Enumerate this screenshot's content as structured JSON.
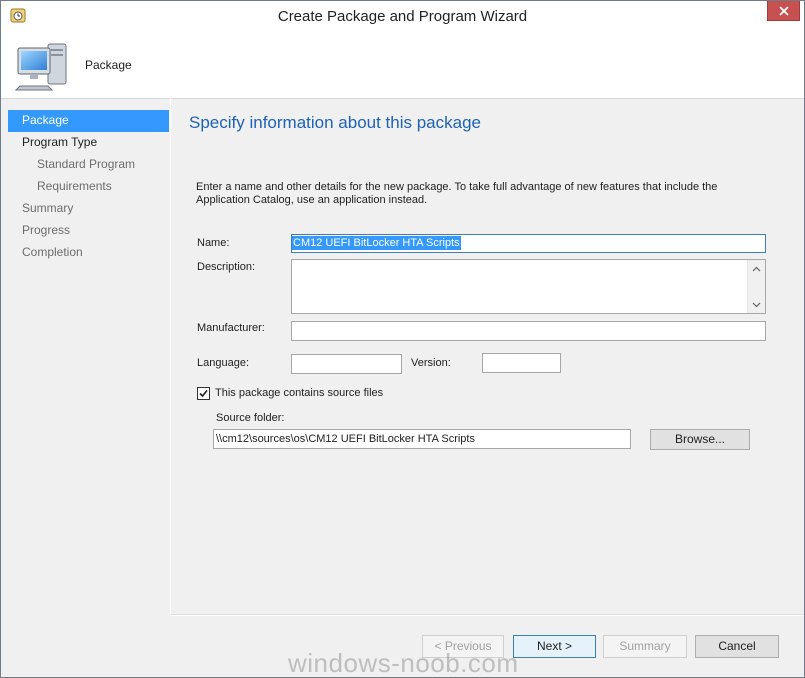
{
  "window": {
    "title": "Create Package and Program Wizard"
  },
  "header": {
    "title": "Package",
    "icon": "computer-icon"
  },
  "nav": {
    "items": [
      {
        "label": "Package",
        "selected": true
      },
      {
        "label": "Program Type"
      },
      {
        "label": "Standard Program"
      },
      {
        "label": "Requirements"
      },
      {
        "label": "Summary"
      },
      {
        "label": "Progress"
      },
      {
        "label": "Completion"
      }
    ]
  },
  "main": {
    "heading": "Specify information about this package",
    "intro": "Enter a name and other details for the new package. To take full advantage of new features that include the Application Catalog, use an application instead.",
    "name_label": "Name:",
    "name_value": "CM12 UEFI BitLocker HTA Scripts",
    "description_label": "Description:",
    "description_value": "",
    "manufacturer_label": "Manufacturer:",
    "manufacturer_value": "",
    "language_label": "Language:",
    "language_value": "",
    "version_label": "Version:",
    "version_value": "",
    "source_checkbox_label": "This package contains source files",
    "source_checkbox_checked": true,
    "source_folder_label": "Source folder:",
    "source_folder_value": "\\\\cm12\\sources\\os\\CM12 UEFI BitLocker HTA Scripts",
    "browse_label": "Browse..."
  },
  "footer": {
    "previous_label": "< Previous",
    "next_label": "Next >",
    "summary_label": "Summary",
    "cancel_label": "Cancel"
  },
  "watermark": "windows-noob.com",
  "colors": {
    "accent": "#3399ff",
    "heading": "#1e61b8",
    "close": "#c75050"
  }
}
